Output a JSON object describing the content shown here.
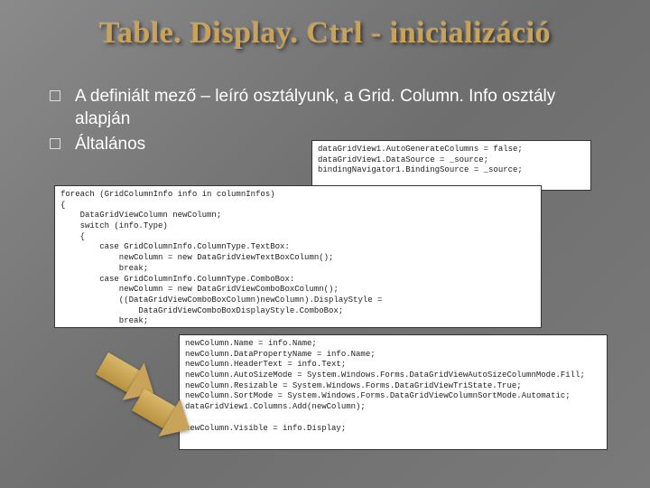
{
  "title": "Table. Display. Ctrl - inicializáció",
  "bullets": [
    "A definiált mező – leíró osztályunk, a Grid. Column. Info osztály alapján",
    "Általános"
  ],
  "code": {
    "top": "dataGridView1.AutoGenerateColumns = false;\ndataGridView1.DataSource = _source;\nbindingNavigator1.BindingSource = _source;",
    "mid": "foreach (GridColumnInfo info in columnInfos)\n{\n    DataGridViewColumn newColumn;\n    switch (info.Type)\n    {\n        case GridColumnInfo.ColumnType.TextBox:\n            newColumn = new DataGridViewTextBoxColumn();\n            break;\n        case GridColumnInfo.ColumnType.ComboBox:\n            newColumn = new DataGridViewComboBoxColumn();\n            ((DataGridViewComboBoxColumn)newColumn).DisplayStyle =\n                DataGridViewComboBoxDisplayStyle.ComboBox;\n            break;",
    "bot": "newColumn.Name = info.Name;\nnewColumn.DataPropertyName = info.Name;\nnewColumn.HeaderText = info.Text;\nnewColumn.AutoSizeMode = System.Windows.Forms.DataGridViewAutoSizeColumnMode.Fill;\nnewColumn.Resizable = System.Windows.Forms.DataGridViewTriState.True;\nnewColumn.SortMode = System.Windows.Forms.DataGridViewColumnSortMode.Automatic;\ndataGridView1.Columns.Add(newColumn);\n\nnewColumn.Visible = info.Display;"
  }
}
